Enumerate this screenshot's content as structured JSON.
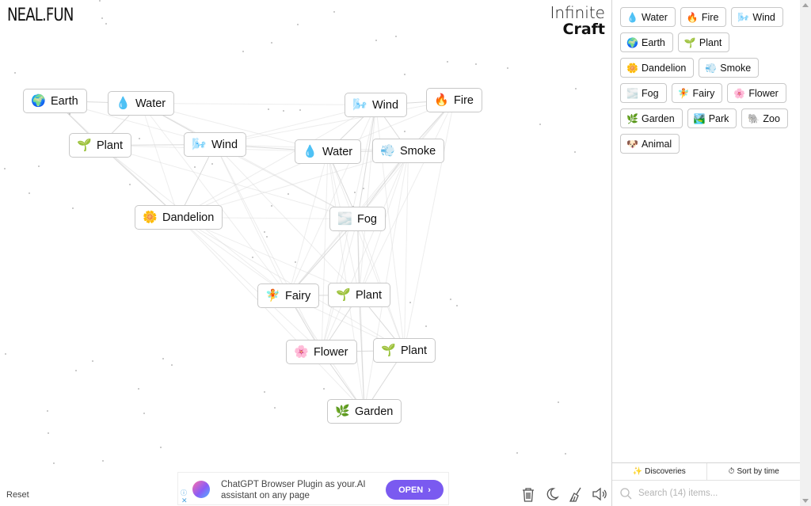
{
  "header": {
    "logo": "NEAL.FUN",
    "title_line1": "Infinite",
    "title_line2": "Craft"
  },
  "canvas_items": [
    {
      "id": "earth1",
      "emoji": "🌍",
      "label": "Earth"
    },
    {
      "id": "water1",
      "emoji": "💧",
      "label": "Water"
    },
    {
      "id": "plant1",
      "emoji": "🌱",
      "label": "Plant"
    },
    {
      "id": "wind1",
      "emoji": "🌬️",
      "label": "Wind"
    },
    {
      "id": "wind2",
      "emoji": "🌬️",
      "label": "Wind"
    },
    {
      "id": "fire1",
      "emoji": "🔥",
      "label": "Fire"
    },
    {
      "id": "water2",
      "emoji": "💧",
      "label": "Water"
    },
    {
      "id": "smoke1",
      "emoji": "💨",
      "label": "Smoke"
    },
    {
      "id": "dandelion1",
      "emoji": "🌼",
      "label": "Dandelion"
    },
    {
      "id": "fog1",
      "emoji": "🌫️",
      "label": "Fog"
    },
    {
      "id": "fairy1",
      "emoji": "🧚",
      "label": "Fairy"
    },
    {
      "id": "plant2",
      "emoji": "🌱",
      "label": "Plant"
    },
    {
      "id": "flower1",
      "emoji": "🌸",
      "label": "Flower"
    },
    {
      "id": "plant3",
      "emoji": "🌱",
      "label": "Plant"
    },
    {
      "id": "garden1",
      "emoji": "🌿",
      "label": "Garden"
    }
  ],
  "sidebar": {
    "items": [
      {
        "emoji": "💧",
        "label": "Water"
      },
      {
        "emoji": "🔥",
        "label": "Fire"
      },
      {
        "emoji": "🌬️",
        "label": "Wind"
      },
      {
        "emoji": "🌍",
        "label": "Earth"
      },
      {
        "emoji": "🌱",
        "label": "Plant"
      },
      {
        "emoji": "🌼",
        "label": "Dandelion"
      },
      {
        "emoji": "💨",
        "label": "Smoke"
      },
      {
        "emoji": "🌫️",
        "label": "Fog"
      },
      {
        "emoji": "🧚",
        "label": "Fairy"
      },
      {
        "emoji": "🌸",
        "label": "Flower"
      },
      {
        "emoji": "🌿",
        "label": "Garden"
      },
      {
        "emoji": "🏞️",
        "label": "Park"
      },
      {
        "emoji": "🐘",
        "label": "Zoo"
      },
      {
        "emoji": "🐶",
        "label": "Animal"
      }
    ],
    "discoveries_label": "Discoveries",
    "sort_label": "Sort by time",
    "search_placeholder": "Search (14) items..."
  },
  "footer": {
    "reset_label": "Reset"
  },
  "ad": {
    "text": "ChatGPT Browser Plugin as your.AI assistant on any page",
    "button_label": "OPEN",
    "info_icon": "ⓘ",
    "close_icon": "✕"
  },
  "colors": {
    "ad_button": "#7a5af0",
    "border": "#c8c8c8"
  }
}
